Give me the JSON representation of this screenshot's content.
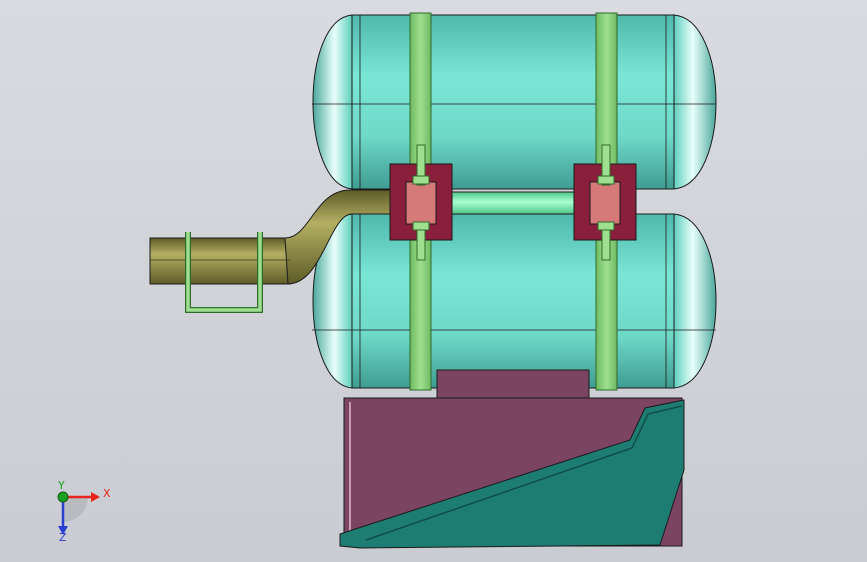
{
  "viewport": {
    "background_top": "#d9dbe0",
    "background_bottom": "#c9ccd2"
  },
  "colors": {
    "tank_body": "#6fd9c8",
    "tank_highlight": "#e9fffb",
    "tank_shade": "#2e8a80",
    "strap": "#8ccf7e",
    "strap_edge": "#2f6b2a",
    "bracket_frame": "#8a1f3c",
    "bracket_pad": "#d57a78",
    "pipe": "#7d7a3c",
    "pipe_light": "#b3af63",
    "connector_pipe": "#7ff0b0",
    "base_panel": "#7b4463",
    "base_ramp": "#1e7d72",
    "outline": "#1a1a1a"
  },
  "triad": {
    "x_label": "X",
    "y_label": "Y",
    "z_label": "Z",
    "x_color": "#e8241c",
    "y_color": "#19a21f",
    "z_color": "#2a3fd0"
  }
}
